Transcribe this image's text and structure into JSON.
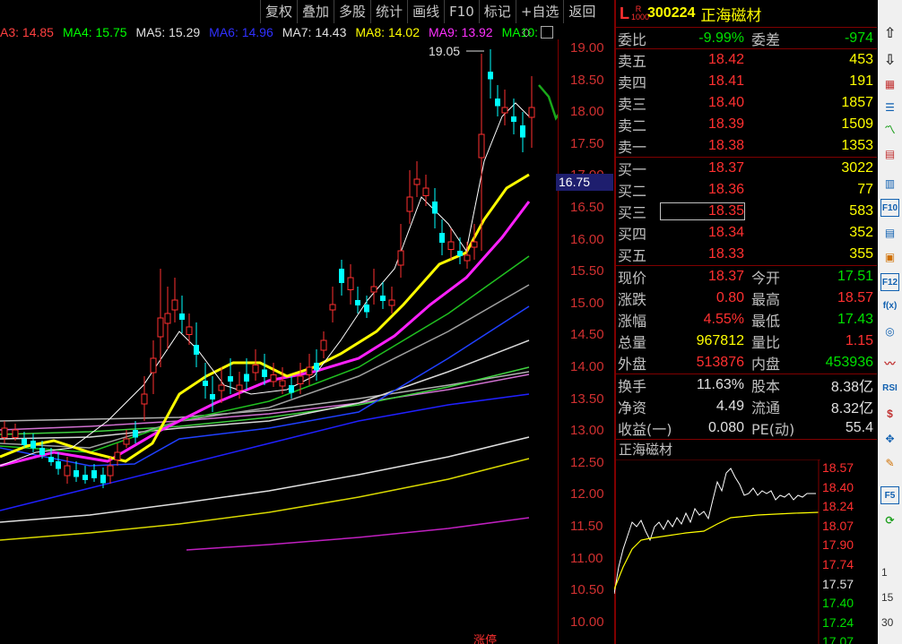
{
  "toolbar": [
    "复权",
    "叠加",
    "多股",
    "统计",
    "画线",
    "F10",
    "标记",
    "+自选",
    "返回"
  ],
  "ma_legend": [
    {
      "label": "A3: 14.85",
      "color": "#ff4040"
    },
    {
      "label": "MA4: 15.75",
      "color": "#00ff00"
    },
    {
      "label": "MA5: 15.29",
      "color": "#e0e0e0"
    },
    {
      "label": "MA6: 14.96",
      "color": "#3030ff"
    },
    {
      "label": "MA7: 14.43",
      "color": "#e0e0e0"
    },
    {
      "label": "MA8: 14.02",
      "color": "#ffff00"
    },
    {
      "label": "MA9: 13.92",
      "color": "#ff30ff"
    },
    {
      "label": "MA10:",
      "color": "#00ff00"
    }
  ],
  "price_axis": [
    "19.00",
    "18.50",
    "18.00",
    "17.50",
    "17.00",
    "16.50",
    "16.00",
    "15.50",
    "15.00",
    "14.50",
    "14.00",
    "13.50",
    "13.00",
    "12.50",
    "12.00",
    "11.50",
    "11.00",
    "10.50",
    "10.00"
  ],
  "high_marker": "19.05",
  "current_price_tag": "16.75",
  "bottom_label": "涨停",
  "stock": {
    "prefix": "L",
    "r": "R",
    "ratio": "1000",
    "code": "300224",
    "name": "正海磁材"
  },
  "weibi": {
    "label": "委比",
    "value": "-9.99%",
    "label2": "委差",
    "value2": "-974"
  },
  "asks": [
    {
      "label": "卖五",
      "price": "18.42",
      "vol": "453"
    },
    {
      "label": "卖四",
      "price": "18.41",
      "vol": "191"
    },
    {
      "label": "卖三",
      "price": "18.40",
      "vol": "1857"
    },
    {
      "label": "卖二",
      "price": "18.39",
      "vol": "1509"
    },
    {
      "label": "卖一",
      "price": "18.38",
      "vol": "1353"
    }
  ],
  "bids": [
    {
      "label": "买一",
      "price": "18.37",
      "vol": "3022"
    },
    {
      "label": "买二",
      "price": "18.36",
      "vol": "77"
    },
    {
      "label": "买三",
      "price": "18.35",
      "vol": "583"
    },
    {
      "label": "买四",
      "price": "18.34",
      "vol": "352"
    },
    {
      "label": "买五",
      "price": "18.33",
      "vol": "355"
    }
  ],
  "stats": [
    {
      "l1": "现价",
      "v1": "18.37",
      "c1": "#ff3030",
      "l2": "今开",
      "v2": "17.51",
      "c2": "#00e000"
    },
    {
      "l1": "涨跌",
      "v1": "0.80",
      "c1": "#ff3030",
      "l2": "最高",
      "v2": "18.57",
      "c2": "#ff3030"
    },
    {
      "l1": "涨幅",
      "v1": "4.55%",
      "c1": "#ff3030",
      "l2": "最低",
      "v2": "17.43",
      "c2": "#00e000"
    },
    {
      "l1": "总量",
      "v1": "967812",
      "c1": "#ffff00",
      "l2": "量比",
      "v2": "1.15",
      "c2": "#ff3030"
    },
    {
      "l1": "外盘",
      "v1": "513876",
      "c1": "#ff3030",
      "l2": "内盘",
      "v2": "453936",
      "c2": "#00e000"
    }
  ],
  "fund": [
    {
      "l1": "换手",
      "v1": "11.63%",
      "l2": "股本",
      "v2": "8.38亿"
    },
    {
      "l1": "净资",
      "v1": "4.49",
      "l2": "流通",
      "v2": "8.32亿"
    },
    {
      "l1": "收益(一)",
      "v1": "0.080",
      "l2": "PE(动)",
      "v2": "55.4"
    }
  ],
  "mini": {
    "title": "正海磁材",
    "prices": [
      "18.57",
      "18.40",
      "18.24",
      "18.07",
      "17.90",
      "17.74",
      "17.57",
      "17.40",
      "17.24",
      "17.07"
    ],
    "pct": [
      "1",
      "15",
      "30"
    ]
  }
}
